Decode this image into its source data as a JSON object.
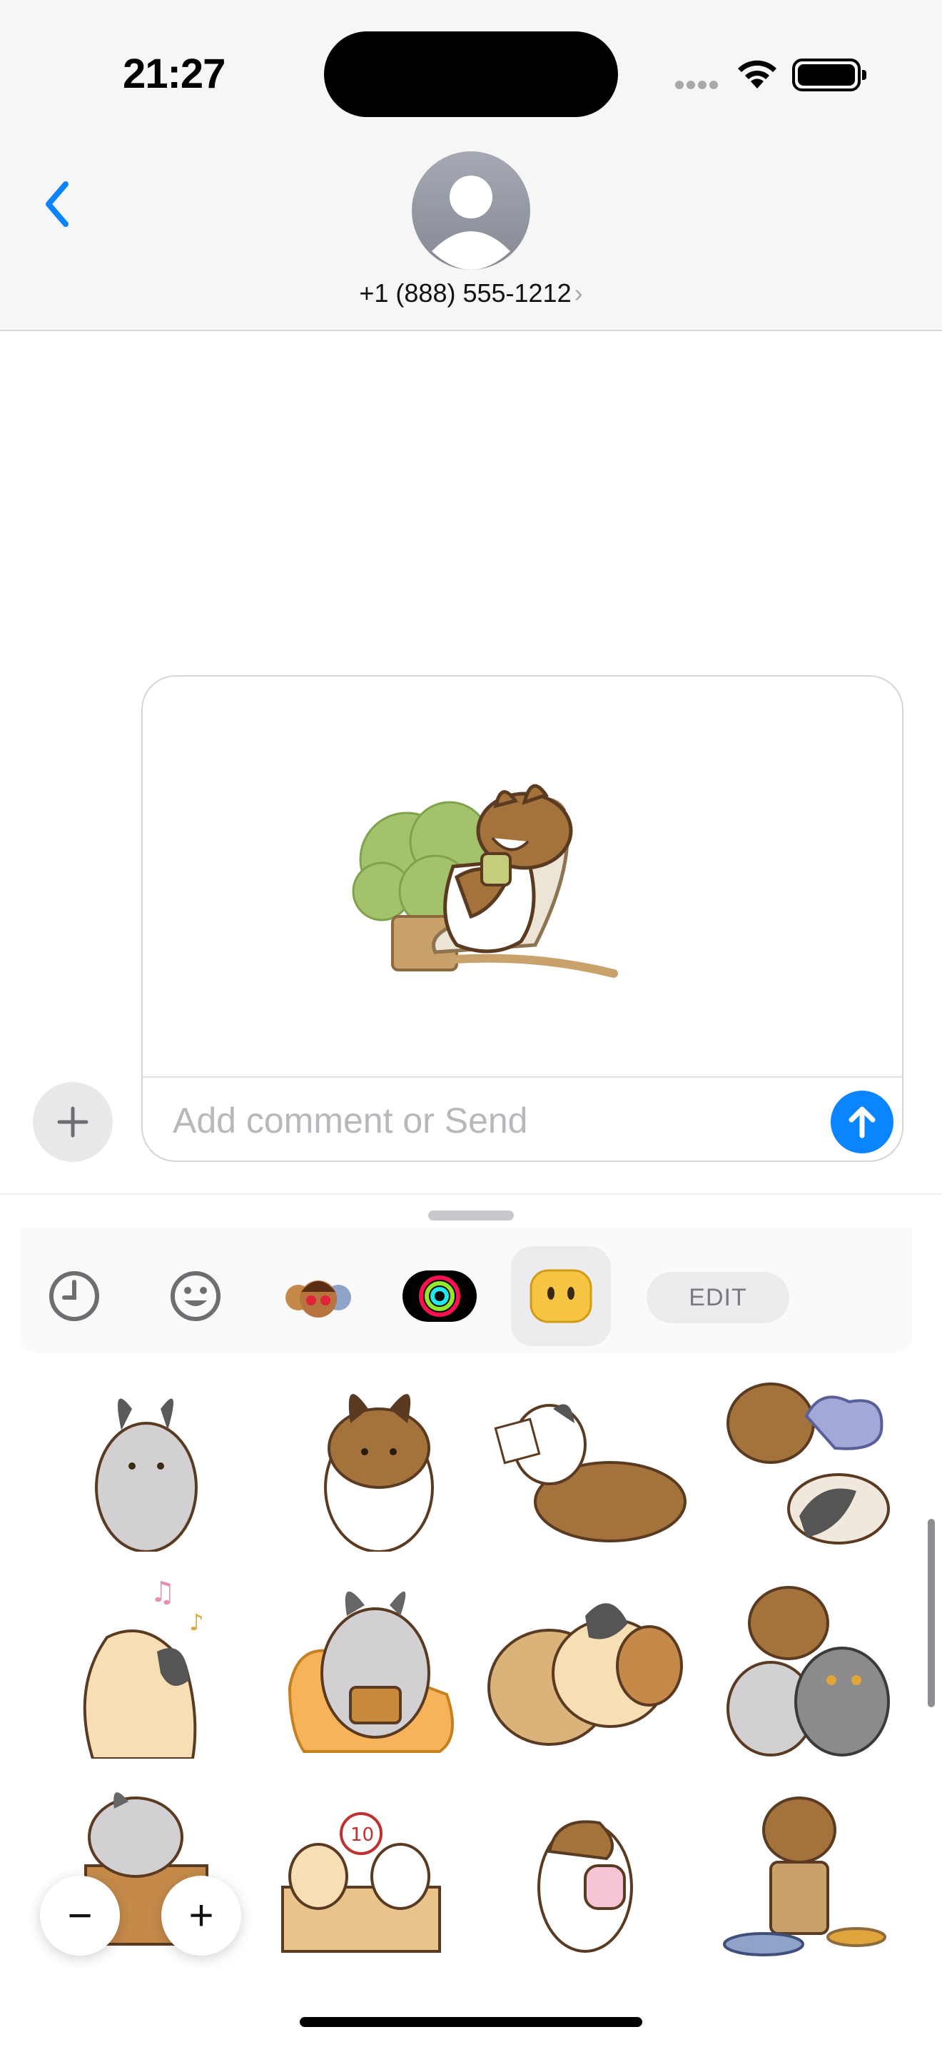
{
  "status_bar": {
    "time": "21:27",
    "icons": [
      "cellular-signal-icon",
      "wifi-icon",
      "battery-icon"
    ]
  },
  "header": {
    "contact_name": "+1 (888) 555-1212",
    "chevron": "›",
    "icons": [
      "back-chevron-icon",
      "contact-avatar-icon"
    ]
  },
  "compose": {
    "placeholder": "Add comment or Send",
    "attached": "sticker",
    "icons": [
      "add-plus-icon",
      "send-arrow-icon"
    ]
  },
  "drawer": {
    "tabs": [
      {
        "icon": "recent-clock-icon"
      },
      {
        "icon": "emoji-face-icon"
      },
      {
        "icon": "memoji-icon"
      },
      {
        "icon": "activity-rings-icon"
      },
      {
        "icon": "sticker-pack-face-icon",
        "selected": true
      }
    ],
    "edit_label": "EDIT",
    "stickers": [
      "gray-bunny",
      "brown-bunny",
      "bunnies-reading",
      "bunnies-sleepy",
      "cream-bunny-music",
      "gray-bunny-snack",
      "bunnies-cuddle",
      "bunnies-and-cat",
      "gray-bunny-on-box",
      "bunnies-scorecard",
      "bunny-with-milk",
      "bunny-on-stool"
    ],
    "zoom_out": "−",
    "zoom_in": "+"
  },
  "colors": {
    "accent": "#0a84ff",
    "bunny_brown": "#a4733c",
    "bunny_gray": "#d2d0d3",
    "bunny_cream": "#f6dfb4",
    "outline": "#5a3b22"
  }
}
